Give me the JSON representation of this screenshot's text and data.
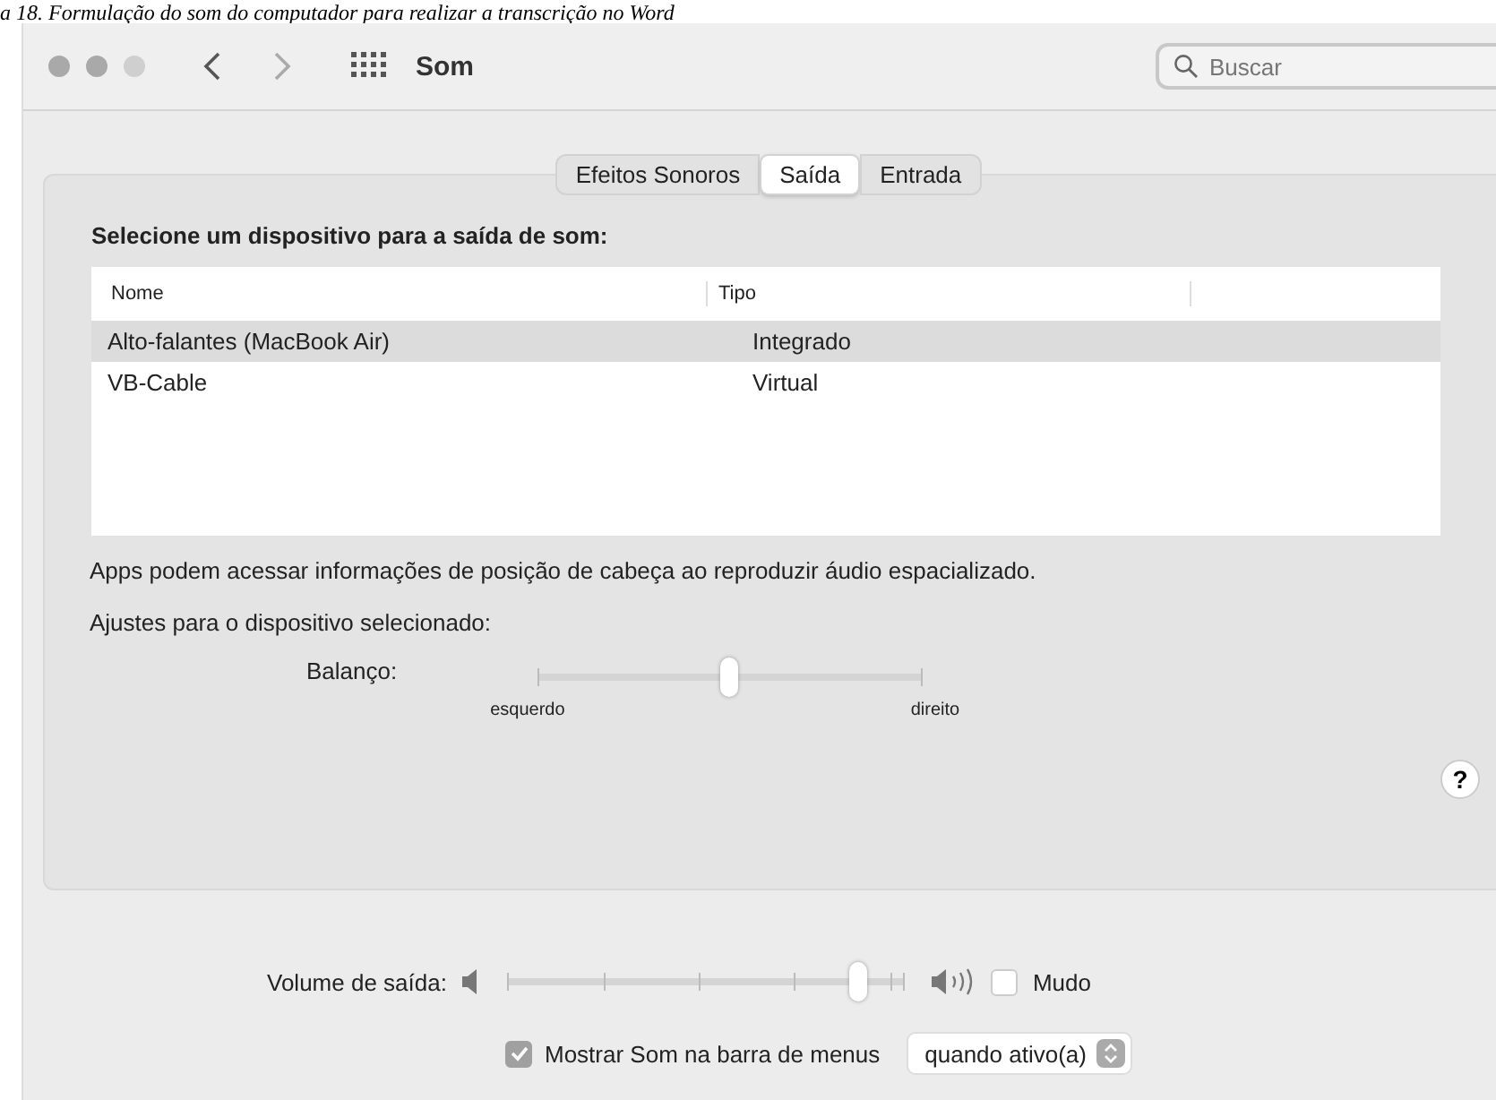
{
  "caption": "a 18. Formulação do som do computador para realizar a transcrição no Word",
  "window": {
    "title": "Som"
  },
  "search": {
    "placeholder": "Buscar"
  },
  "tabs": [
    {
      "label": "Efeitos Sonoros",
      "selected": false
    },
    {
      "label": "Saída",
      "selected": true
    },
    {
      "label": "Entrada",
      "selected": false
    }
  ],
  "device_heading": "Selecione um dispositivo para a saída de som:",
  "table": {
    "columns": [
      "Nome",
      "Tipo"
    ],
    "rows": [
      {
        "cells": [
          "Alto-falantes (MacBook Air)",
          "Integrado"
        ],
        "selected": true
      },
      {
        "cells": [
          "VB-Cable",
          "Virtual"
        ],
        "selected": false
      }
    ]
  },
  "info_text": "Apps podem acessar informações de posição de cabeça ao reproduzir áudio espacializado.",
  "settings_label": "Ajustes para o dispositivo selecionado:",
  "balance": {
    "label": "Balanço:",
    "level": 0.5,
    "left_label": "esquerdo",
    "right_label": "direito"
  },
  "help": "?",
  "volume": {
    "label": "Volume de saída:",
    "level": 0.88
  },
  "mute": {
    "label": "Mudo",
    "checked": false
  },
  "menu_bar": {
    "label": "Mostrar Som na barra de menus",
    "checked": true,
    "option": "quando ativo(a)"
  }
}
